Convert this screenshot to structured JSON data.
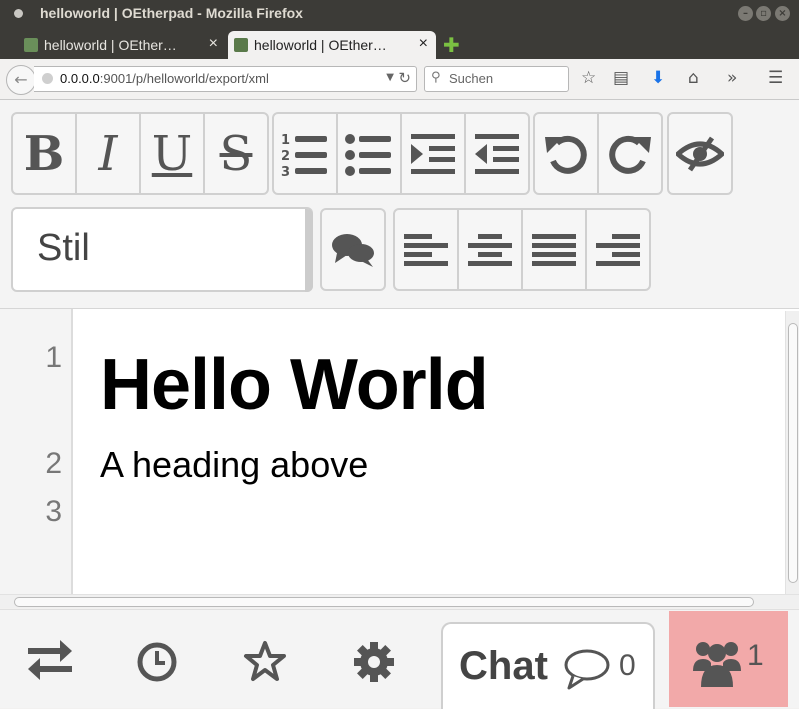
{
  "window": {
    "title": "helloworld | OEtherpad - Mozilla Firefox"
  },
  "tabs": [
    {
      "label": "helloworld | OEther…",
      "active": false
    },
    {
      "label": "helloworld | OEther…",
      "active": true
    }
  ],
  "navbar": {
    "url_host": "0.0.0.0",
    "url_rest": ":9001/p/helloworld/export/xml",
    "search_placeholder": "Suchen"
  },
  "toolbar": {
    "bold": "B",
    "italic": "I",
    "underline": "U",
    "strikethrough": "S",
    "style_select": "Stil"
  },
  "editor": {
    "line_numbers": [
      "1",
      "2",
      "3"
    ],
    "line1": "Hello World",
    "line2": "A heading above"
  },
  "bottombar": {
    "chat_label": "Chat",
    "chat_count": "0",
    "users_count": "1"
  },
  "colors": {
    "titlebar": "#3c3b37",
    "users_bg": "#f2a9a9",
    "icon": "#555555"
  }
}
